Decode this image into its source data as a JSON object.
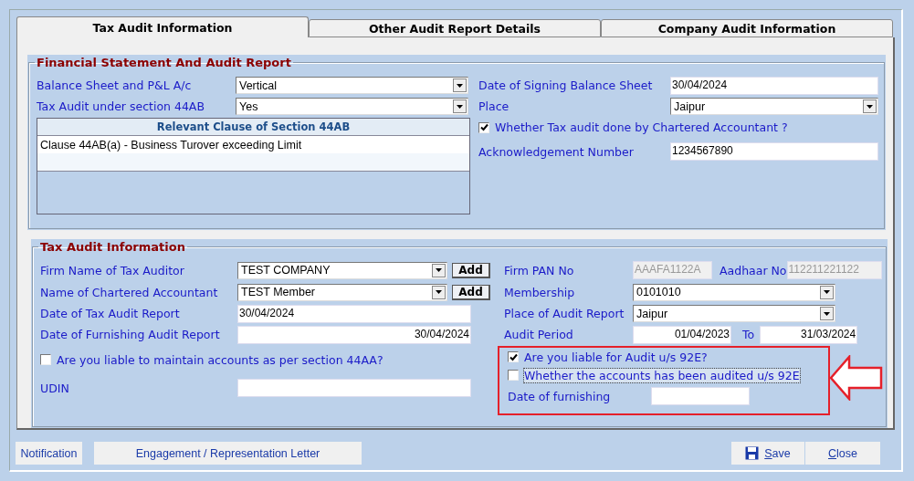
{
  "tabs": [
    {
      "label": "Tax Audit Information",
      "selected": true
    },
    {
      "label": "Other Audit Report Details",
      "selected": false
    },
    {
      "label": "Company Audit Information",
      "selected": false
    }
  ],
  "financial_group": {
    "title": "Financial Statement And Audit Report",
    "balance_sheet": {
      "label": "Balance Sheet and P&L A/c",
      "value": "Vertical"
    },
    "tax_audit_44ab": {
      "label": "Tax Audit  under section 44AB",
      "value": "Yes"
    },
    "clause_table": {
      "header": "Relevant Clause of Section 44AB",
      "rows": [
        "Clause 44AB(a) - Business Turover exceeding Limit"
      ]
    },
    "date_of_signing": {
      "label": "Date of Signing Balance Sheet",
      "value": "30/04/2024"
    },
    "place": {
      "label": "Place",
      "value": "Jaipur"
    },
    "ca_check": {
      "label": "Whether Tax audit done by Chartered Accountant ?",
      "checked": true
    },
    "acknowledgement": {
      "label": "Acknowledgement Number",
      "value": "1234567890"
    }
  },
  "tax_audit_group": {
    "title": "Tax Audit Information",
    "firm_name": {
      "label": "Firm Name of Tax Auditor",
      "value": "TEST COMPANY",
      "button": "Add"
    },
    "ca_name": {
      "label": "Name of Chartered Accountant",
      "value": "TEST Member",
      "button": "Add"
    },
    "report_date": {
      "label": "Date of Tax Audit Report",
      "value": "30/04/2024"
    },
    "furnishing_date": {
      "label": "Date of Furnishing Audit Report",
      "value": "30/04/2024"
    },
    "section_44aa": {
      "label": "Are you liable to maintain accounts as per section 44AA?",
      "checked": false
    },
    "udin": {
      "label": "UDIN"
    },
    "firm_pan": {
      "label": "Firm PAN No",
      "value": "AAAFA1122A",
      "disabled": true
    },
    "aadhaar": {
      "label": "Aadhaar No",
      "value": "112211221122",
      "disabled": true
    },
    "membership": {
      "label": "Membership",
      "value": "0101010"
    },
    "place_of_report": {
      "label": "Place of Audit Report",
      "value": "Jaipur"
    },
    "audit_period": {
      "label": "Audit Period",
      "from": "01/04/2023",
      "to_label": "To",
      "to": "31/03/2024"
    },
    "liable_92e": {
      "label": "Are you liable for Audit  u/s 92E?",
      "checked": true,
      "focused": false
    },
    "audited_92e": {
      "label": "Whether the accounts has been audited u/s 92E",
      "checked": false,
      "focused": true
    },
    "date_of_furnishing": {
      "label": "Date of furnishing"
    }
  },
  "footer": {
    "left_buttons": [
      "Notification",
      "Engagement / Representation Letter"
    ],
    "save": {
      "label": "Save"
    },
    "close": {
      "label": "Close"
    }
  }
}
